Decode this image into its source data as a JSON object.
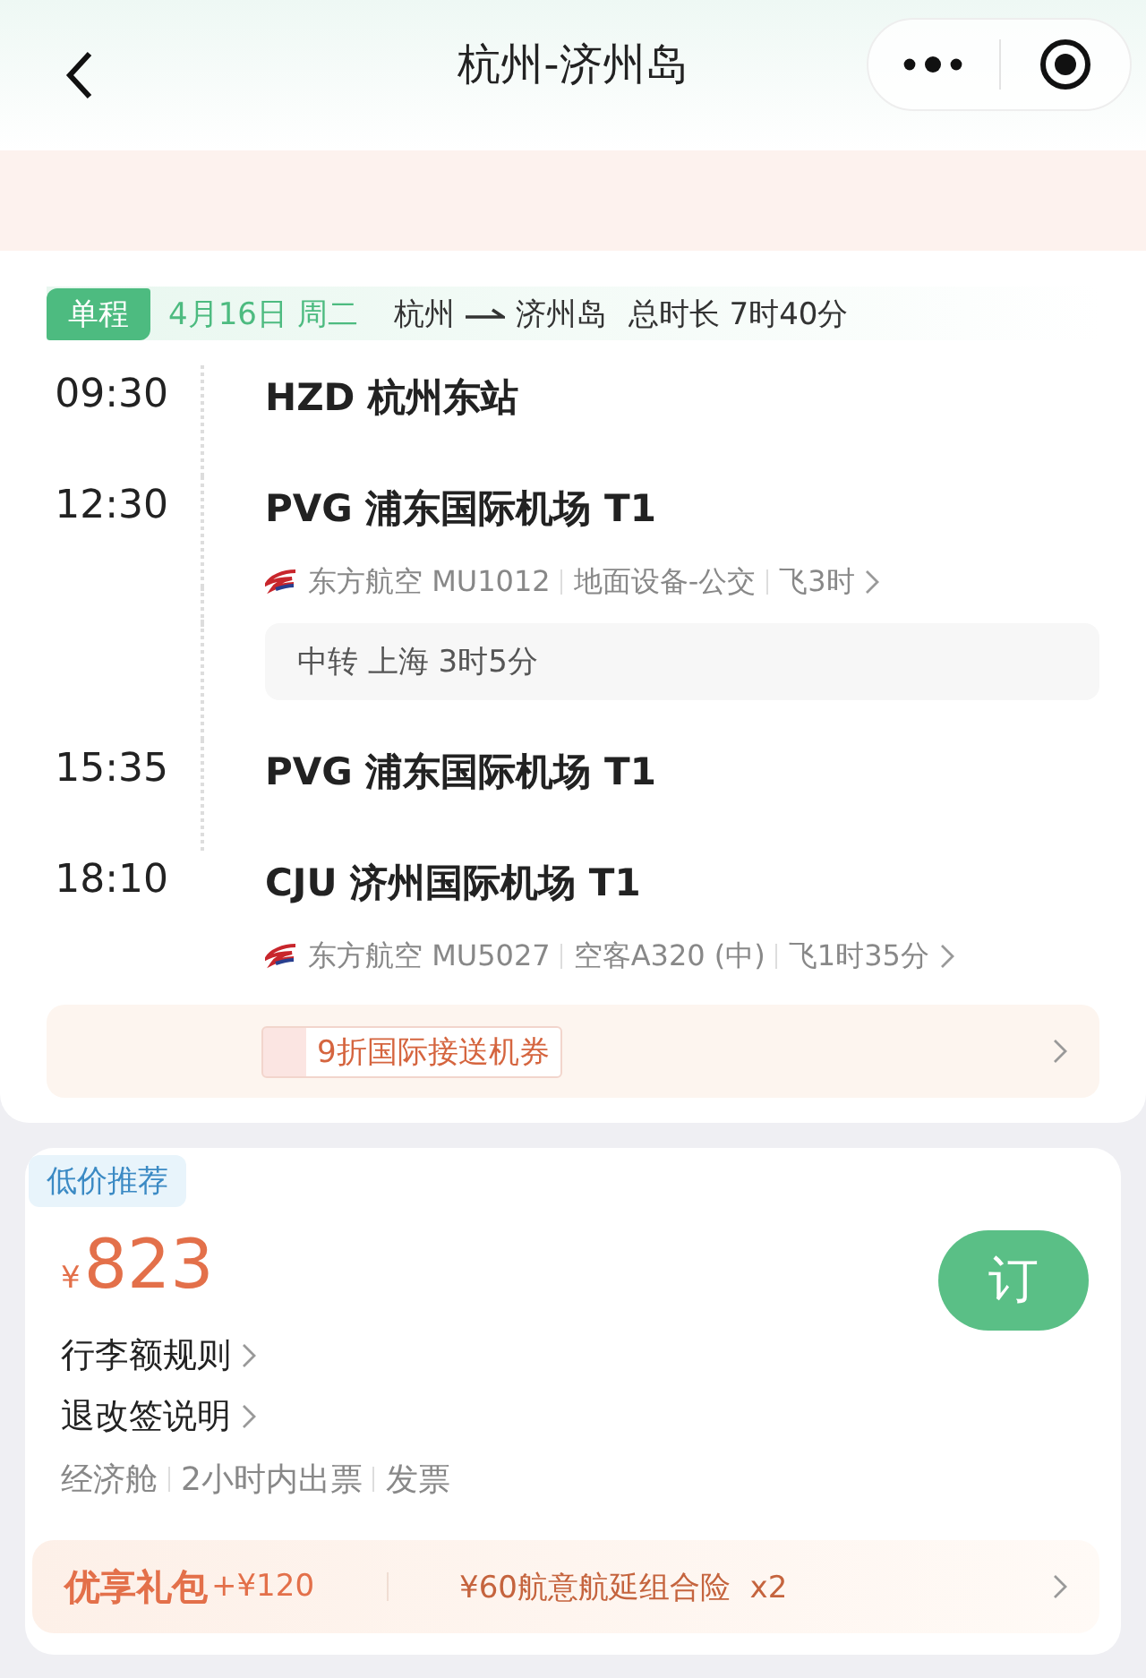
{
  "nav": {
    "title": "杭州-济州岛"
  },
  "trip": {
    "tag": "单程",
    "date": "4月16日 周二",
    "from": "杭州",
    "to": "济州岛",
    "duration": "总时长 7时40分"
  },
  "legs": [
    {
      "kind": "stop",
      "time": "09:30",
      "station": "HZD 杭州东站"
    },
    {
      "kind": "stop",
      "time": "12:30",
      "station": "PVG 浦东国际机场 T1"
    },
    {
      "kind": "carrier",
      "airline": "东方航空 MU1012",
      "equipment": "地面设备-公交",
      "flight_time": "飞3时"
    },
    {
      "kind": "transfer",
      "text": "中转 上海 3时5分"
    },
    {
      "kind": "stop",
      "time": "15:35",
      "station": "PVG 浦东国际机场 T1"
    },
    {
      "kind": "stop",
      "time": "18:10",
      "station": "CJU 济州国际机场 T1"
    },
    {
      "kind": "carrier",
      "airline": "东方航空 MU5027",
      "equipment": "空客A320 (中)",
      "flight_time": "飞1时35分"
    }
  ],
  "coupon": {
    "text": "9折国际接送机券"
  },
  "offer": {
    "tag": "低价推荐",
    "currency": "¥",
    "price": "823",
    "book": "订",
    "links": [
      "行李额规则",
      "退改签说明"
    ],
    "features": [
      "经济舱",
      "2小时内出票",
      "发票"
    ],
    "package": {
      "title": "优享礼包",
      "amount": "+¥120",
      "detail": "¥60航意航延组合险  x2"
    }
  }
}
